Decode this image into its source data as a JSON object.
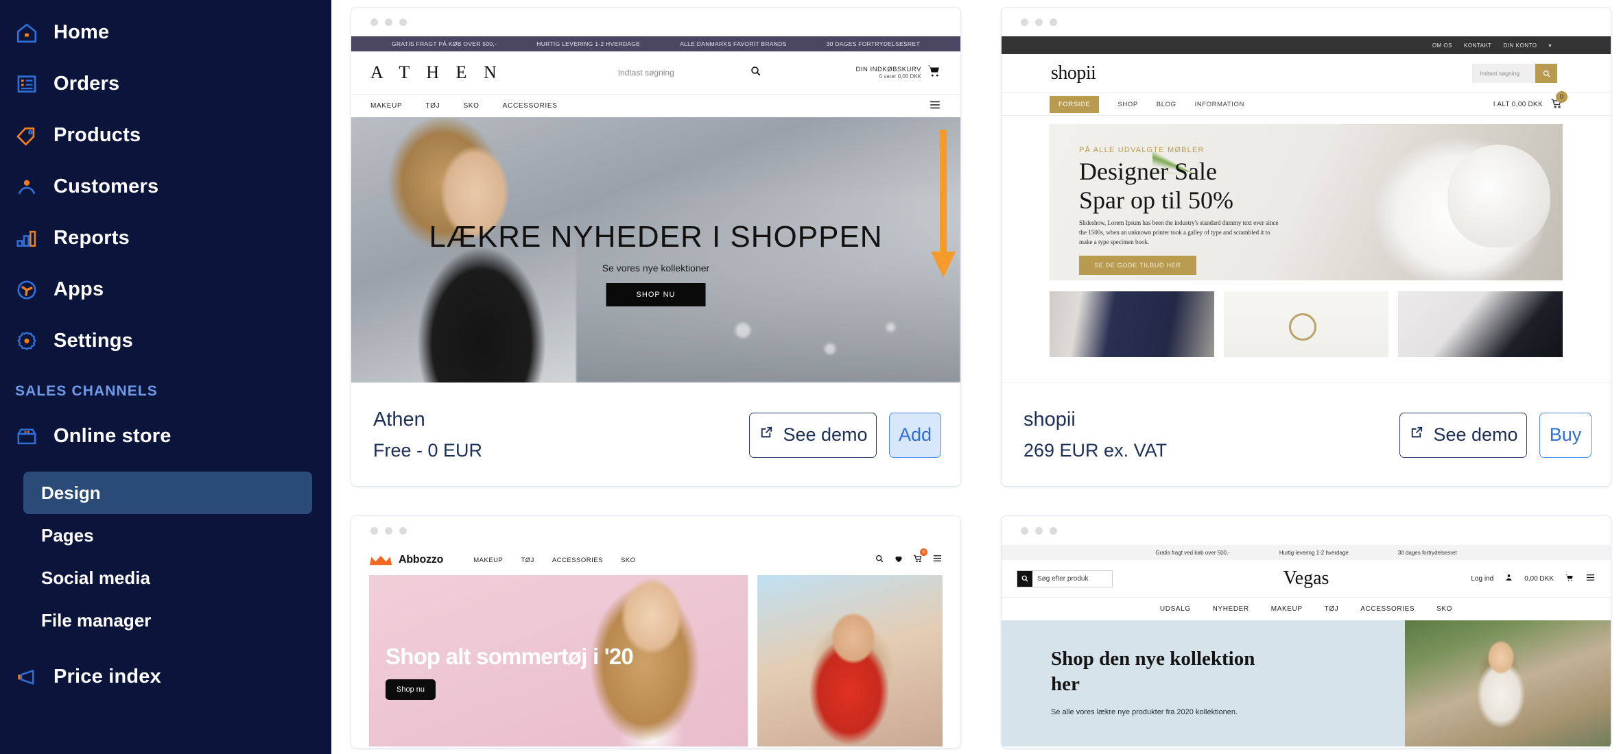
{
  "sidebar": {
    "nav": [
      {
        "label": "Home",
        "icon": "home-icon"
      },
      {
        "label": "Orders",
        "icon": "orders-icon"
      },
      {
        "label": "Products",
        "icon": "products-tag-icon"
      },
      {
        "label": "Customers",
        "icon": "customers-person-icon"
      },
      {
        "label": "Reports",
        "icon": "reports-bar-chart-icon"
      },
      {
        "label": "Apps",
        "icon": "apps-icon"
      },
      {
        "label": "Settings",
        "icon": "settings-gear-icon"
      }
    ],
    "section_title": "SALES CHANNELS",
    "online_store": {
      "label": "Online store",
      "icon": "store-icon"
    },
    "sub_items": [
      {
        "label": "Design",
        "active": true
      },
      {
        "label": "Pages",
        "active": false
      },
      {
        "label": "Social media",
        "active": false
      },
      {
        "label": "File manager",
        "active": false
      }
    ],
    "price_index": {
      "label": "Price index",
      "icon": "megaphone-icon"
    },
    "colors": {
      "bg": "#0b143a",
      "active_bg": "#2a4a78",
      "section_text": "#6f9ae8",
      "accent": "#f07f1a"
    }
  },
  "annotation": {
    "arrow_color": "#f59b2c",
    "points_to": "add-button-athen"
  },
  "themes": [
    {
      "name": "Athen",
      "price": "Free - 0 EUR",
      "demo_label": "See demo",
      "action_label": "Add",
      "action_kind": "add",
      "preview": {
        "promo": [
          "GRATIS FRAGT PÅ KØB OVER 500,-",
          "HURTIG LEVERING 1-2 HVERDAGE",
          "ALLE DANMARKS FAVORIT BRANDS",
          "30 DAGES FORTRYDELSESRET"
        ],
        "logo": "A T H E N",
        "search_placeholder": "Indtast søgning",
        "cart_line1": "DIN INDKØBSKURV",
        "cart_line2": "0 varer 0,00 DKK",
        "nav": [
          "MAKEUP",
          "TØJ",
          "SKO",
          "ACCESSORIES"
        ],
        "hero_title": "LÆKRE NYHEDER I SHOPPEN",
        "hero_sub": "Se vores nye kollektioner",
        "hero_cta": "SHOP NU"
      }
    },
    {
      "name": "shopii",
      "price": "269 EUR ex. VAT",
      "demo_label": "See demo",
      "action_label": "Buy",
      "action_kind": "buy",
      "preview": {
        "topbar": [
          "OM OS",
          "KONTAKT",
          "DIN KONTO"
        ],
        "logo": "shopii",
        "search_placeholder": "Indtast søgning",
        "nav": [
          "FORSIDE",
          "SHOP",
          "BLOG",
          "INFORMATION"
        ],
        "cart_total": "I ALT 0,00 DKK",
        "cart_badge": "0",
        "hero_eyebrow": "PÅ ALLE UDVALGTE MØBLER",
        "hero_title_line1": "Designer Sale",
        "hero_title_line2": "Spar op til 50%",
        "hero_body": "Slideshow, Lorem Ipsum has been the industry's standard dummy text ever since the 1500s, when an unknown printer took a galley of type and scrambled it to make a type specimen book.",
        "hero_cta": "SE DE GODE TILBUD HER"
      }
    },
    {
      "name": "Abbozzo",
      "preview": {
        "logo": "Abbozzo",
        "nav": [
          "MAKEUP",
          "TØJ",
          "ACCESSORIES",
          "SKO"
        ],
        "cart_badge": "0",
        "hero_title": "Shop alt sommertøj i '20",
        "hero_cta": "Shop nu"
      }
    },
    {
      "name": "Vegas",
      "preview": {
        "promo": [
          "Gratis fragt ved køb over 500,-",
          "Hurtig levering 1-2 hverdage",
          "30 dages fortrydelsesret"
        ],
        "search_placeholder": "Søg efter produk",
        "logo": "Vegas",
        "login_label": "Log ind",
        "cart_total": "0,00 DKK",
        "nav": [
          "UDSALG",
          "NYHEDER",
          "MAKEUP",
          "TØJ",
          "ACCESSORIES",
          "SKO"
        ],
        "hero_title": "Shop den nye kollektion her",
        "hero_sub": "Se alle vores lækre nye produkter fra 2020 kollektionen."
      }
    }
  ]
}
